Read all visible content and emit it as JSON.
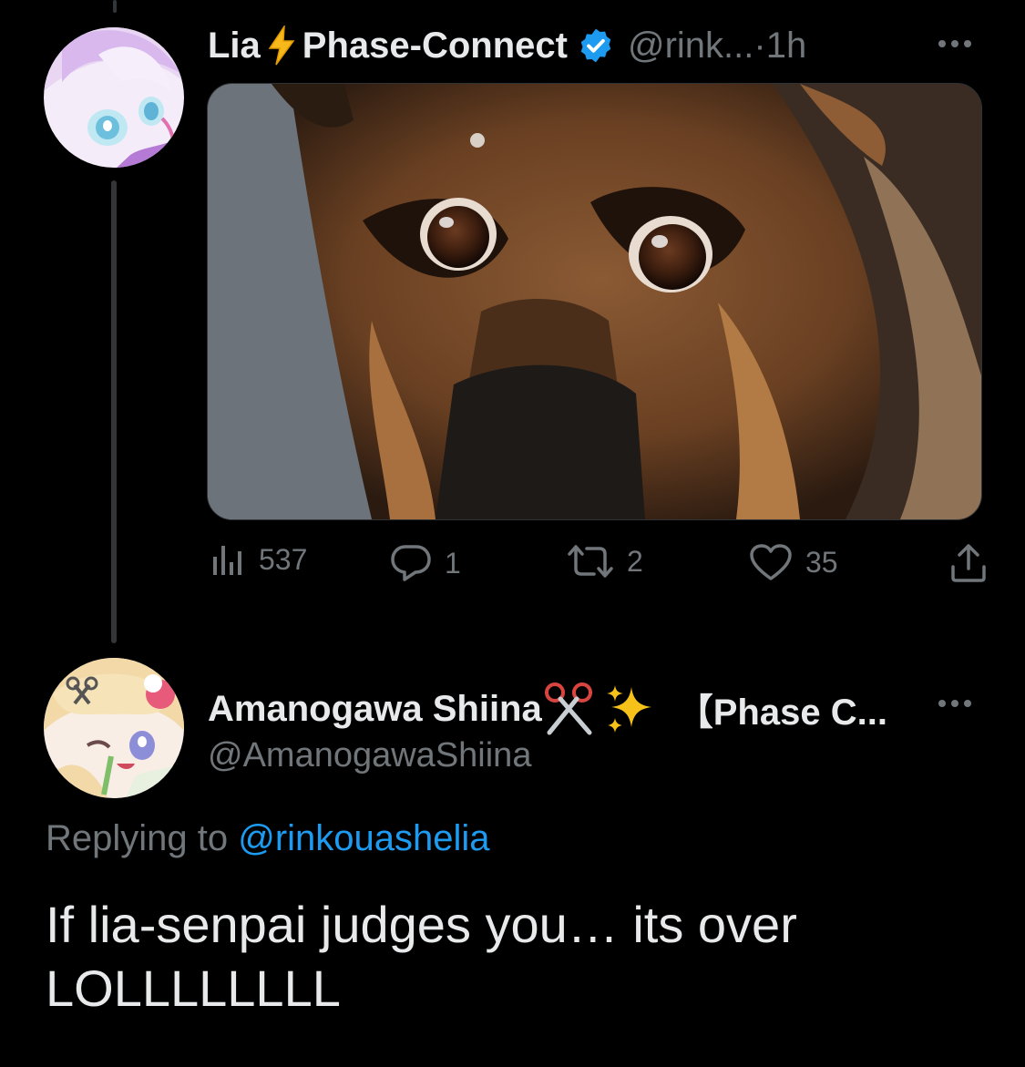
{
  "tweet1": {
    "author_name": "Lia",
    "author_affiliation": "Phase-Connect",
    "handle": "@rink...",
    "separator": " · ",
    "time": "1h",
    "verified": true,
    "media_description_icon": "dog-photo",
    "stats": {
      "views": "537",
      "replies": "1",
      "retweets": "2",
      "likes": "35"
    }
  },
  "tweet2": {
    "author_name": "Amanogawa Shiina",
    "author_suffix": "【Phase C...",
    "handle": "@AmanogawaShiina",
    "replying_prefix": "Replying to ",
    "replying_to": "@rinkouashelia",
    "text_line1": "If lia-senpai judges you… its over",
    "text_line2": "LOLLLLLLLL"
  },
  "colors": {
    "background": "#000000",
    "text_primary": "#e7e9ea",
    "text_secondary": "#71767b",
    "accent": "#1d9bf0",
    "thread_line": "#333639"
  }
}
